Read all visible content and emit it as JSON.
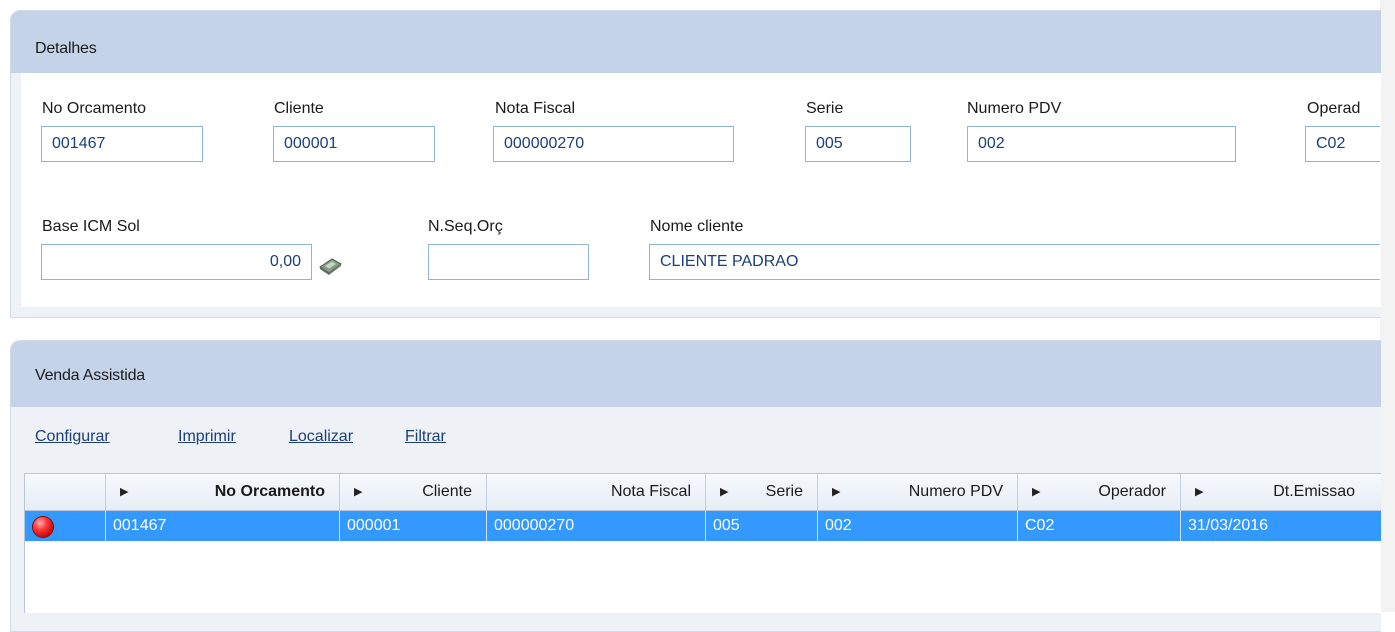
{
  "detalhes": {
    "title": "Detalhes",
    "fields": {
      "no_orcamento": {
        "label": "No Orcamento",
        "value": "001467"
      },
      "cliente": {
        "label": "Cliente",
        "value": "000001"
      },
      "nota_fiscal": {
        "label": "Nota Fiscal",
        "value": "000000270"
      },
      "serie": {
        "label": "Serie",
        "value": "005"
      },
      "numero_pdv": {
        "label": "Numero PDV",
        "value": "002"
      },
      "operador": {
        "label": "Operad",
        "value": "C02"
      },
      "base_icm_sol": {
        "label": "Base ICM Sol",
        "value": "0,00"
      },
      "nseq_orc": {
        "label": "N.Seq.Orç",
        "value": ""
      },
      "nome_cliente": {
        "label": "Nome cliente",
        "value": "CLIENTE PADRAO"
      }
    }
  },
  "venda_assistida": {
    "title": "Venda Assistida",
    "toolbar": [
      "Configurar",
      "Imprimir",
      "Localizar",
      "Filtrar"
    ],
    "grid": {
      "columns": [
        "",
        "No Orcamento",
        "Cliente",
        "Nota Fiscal",
        "Serie",
        "Numero PDV",
        "Operador",
        "Dt.Emissao"
      ],
      "rows": [
        {
          "status": "red",
          "cells": [
            "001467",
            "000001",
            "000000270",
            "005",
            "002",
            "C02",
            "31/03/2016"
          ]
        }
      ]
    }
  },
  "colors": {
    "panel_header": "#c5d3e9",
    "link": "#1c3f78",
    "selected_row": "#3399ff",
    "status_red": "#e00000"
  },
  "icons": [
    "calculator-icon",
    "sort-arrow-icon",
    "status-red-icon"
  ]
}
